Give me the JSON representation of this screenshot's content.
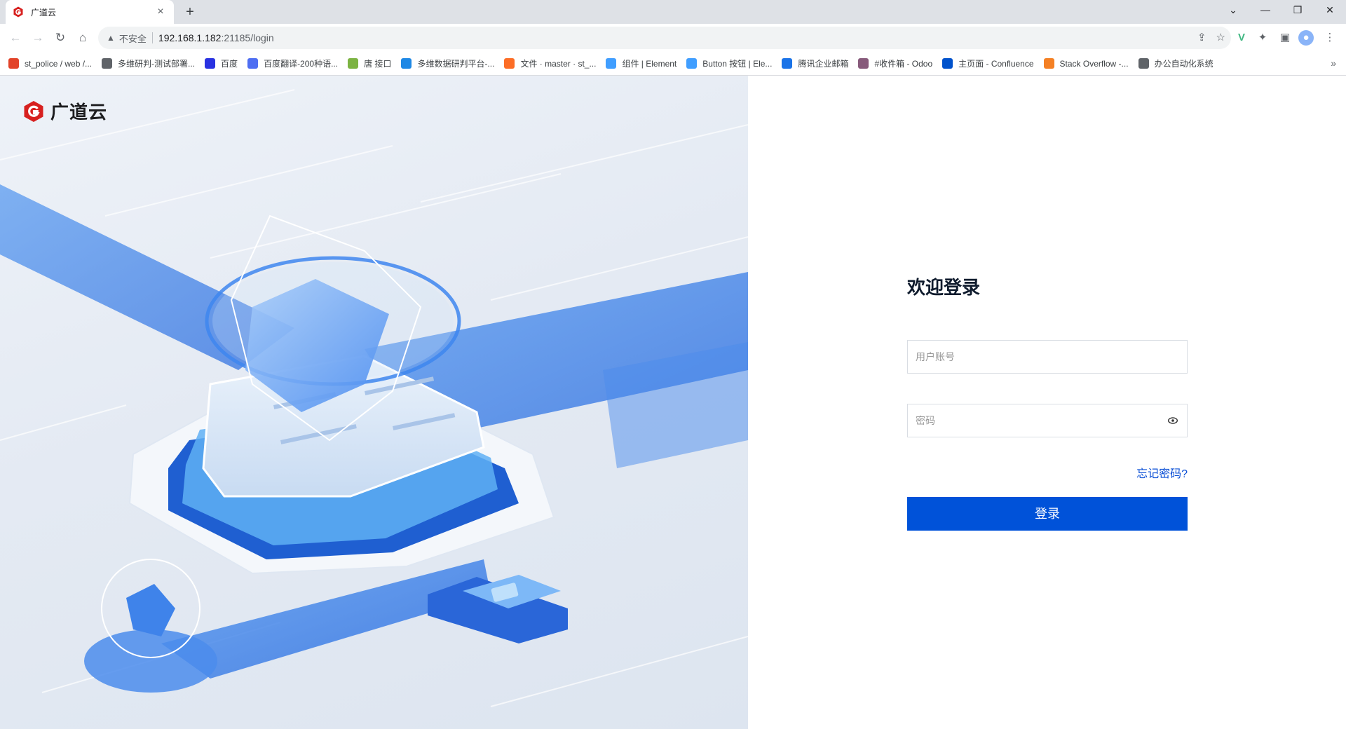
{
  "browser": {
    "tab_title": "广道云",
    "new_tab": "+",
    "security_label": "不安全",
    "url_host": "192.168.1.182",
    "url_rest": ":21185/login",
    "bookmarks": [
      {
        "label": "st_police / web /...",
        "icon": "gitlab-icon",
        "color": "#e24329"
      },
      {
        "label": "多维研判-测试部署...",
        "icon": "globe-icon",
        "color": "#5f6368"
      },
      {
        "label": "百度",
        "icon": "baidu-icon",
        "color": "#2932e1"
      },
      {
        "label": "百度翻译-200种语...",
        "icon": "translate-icon",
        "color": "#4e6ef2"
      },
      {
        "label": "唐 接口",
        "icon": "api-icon",
        "color": "#7cb342"
      },
      {
        "label": "多维数据研判平台-...",
        "icon": "edge-icon",
        "color": "#1e88e5"
      },
      {
        "label": "文件 · master · st_...",
        "icon": "gitlab-icon",
        "color": "#fc6d26"
      },
      {
        "label": "组件 | Element",
        "icon": "element-icon",
        "color": "#409eff"
      },
      {
        "label": "Button 按钮 | Ele...",
        "icon": "element-icon",
        "color": "#409eff"
      },
      {
        "label": "腾讯企业邮箱",
        "icon": "mail-icon",
        "color": "#1a73e8"
      },
      {
        "label": "#收件箱 - Odoo",
        "icon": "odoo-icon",
        "color": "#875a7b"
      },
      {
        "label": "主页面 - Confluence",
        "icon": "confluence-icon",
        "color": "#0052cc"
      },
      {
        "label": "Stack Overflow -...",
        "icon": "stackoverflow-icon",
        "color": "#f48024"
      },
      {
        "label": "办公自动化系统",
        "icon": "globe-icon",
        "color": "#5f6368"
      }
    ],
    "bookmarks_more": "»"
  },
  "hero": {
    "brand_name": "广道云",
    "accent": "#2f7ef5"
  },
  "login": {
    "title": "欢迎登录",
    "username_placeholder": "用户账号",
    "password_placeholder": "密码",
    "forgot_label": "忘记密码?",
    "submit_label": "登录",
    "primary_color": "#0052d9"
  }
}
